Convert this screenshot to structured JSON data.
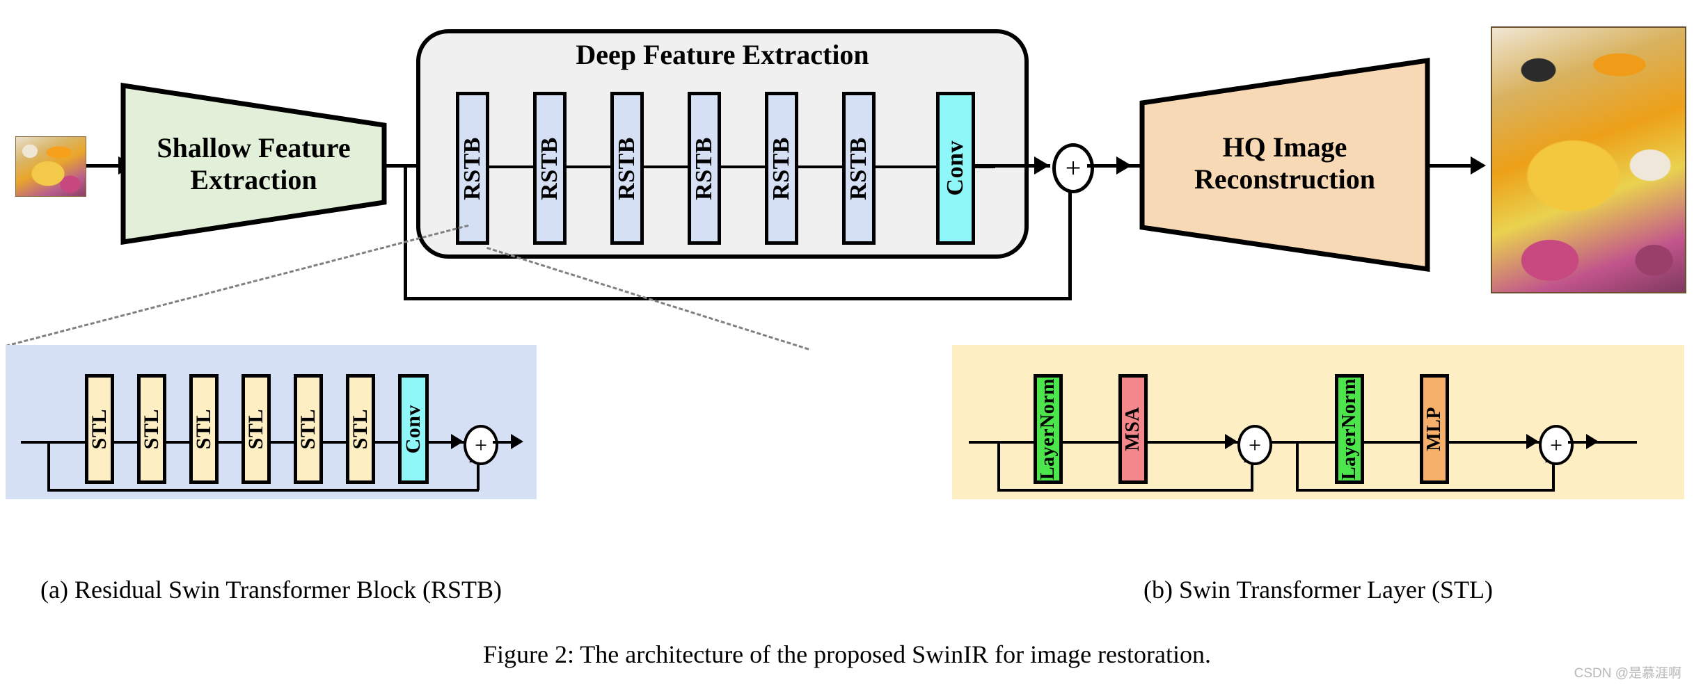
{
  "figure": {
    "caption": "Figure 2: The architecture of the proposed SwinIR for image restoration.",
    "watermark": "CSDN @是慕涯啊"
  },
  "top_pipeline": {
    "input_image_alt": "low quality butterfly input image",
    "shallow": {
      "line1": "Shallow Feature",
      "line2": "Extraction",
      "color": "#e2efd9"
    },
    "deep": {
      "title": "Deep Feature Extraction",
      "bg": "#f0f0f0",
      "blocks": [
        {
          "label": "RSTB",
          "color": "#d6e0f5"
        },
        {
          "label": "RSTB",
          "color": "#d6e0f5"
        },
        {
          "label": "RSTB",
          "color": "#d6e0f5"
        },
        {
          "label": "RSTB",
          "color": "#d6e0f5"
        },
        {
          "label": "RSTB",
          "color": "#d6e0f5"
        },
        {
          "label": "RSTB",
          "color": "#d6e0f5"
        },
        {
          "label": "Conv",
          "color": "#8ff7f7"
        }
      ]
    },
    "add_symbol": "+",
    "reconstruction": {
      "line1": "HQ Image",
      "line2": "Reconstruction",
      "color": "#f7d9b5"
    },
    "output_image_alt": "high quality butterfly output image"
  },
  "panel_a": {
    "caption": "(a) Residual Swin Transformer Block (RSTB)",
    "bg": "#d6e0f5",
    "blocks": [
      {
        "label": "STL",
        "color": "#fdeec4"
      },
      {
        "label": "STL",
        "color": "#fdeec4"
      },
      {
        "label": "STL",
        "color": "#fdeec4"
      },
      {
        "label": "STL",
        "color": "#fdeec4"
      },
      {
        "label": "STL",
        "color": "#fdeec4"
      },
      {
        "label": "STL",
        "color": "#fdeec4"
      },
      {
        "label": "Conv",
        "color": "#8ff7f7"
      }
    ],
    "add_symbol": "+"
  },
  "panel_b": {
    "caption": "(b) Swin Transformer Layer (STL)",
    "bg": "#fdeec4",
    "blocks": [
      {
        "label": "LayerNorm",
        "color": "#4ce54c"
      },
      {
        "label": "MSA",
        "color": "#f4878b"
      },
      {
        "label": "LayerNorm",
        "color": "#4ce54c"
      },
      {
        "label": "MLP",
        "color": "#f7b06a"
      }
    ],
    "add_symbols": [
      "+",
      "+"
    ]
  }
}
